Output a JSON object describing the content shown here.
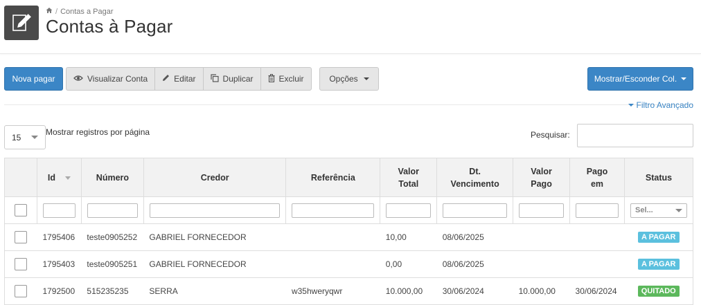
{
  "header": {
    "breadcrumb": [
      "Contas a Pagar"
    ],
    "title": "Contas à Pagar"
  },
  "toolbar": {
    "new_label": "Nova pagar",
    "view_label": "Visualizar Conta",
    "edit_label": "Editar",
    "duplicate_label": "Duplicar",
    "delete_label": "Excluir",
    "options_label": "Opções",
    "columns_label": "Mostrar/Esconder Col."
  },
  "filter_link": "Filtro Avançado",
  "page_size": {
    "value": "15",
    "label": "Mostrar registros por página"
  },
  "search": {
    "label": "Pesquisar:",
    "value": ""
  },
  "table": {
    "columns": [
      {
        "key": "id",
        "label": "Id"
      },
      {
        "key": "numero",
        "label": "Número"
      },
      {
        "key": "credor",
        "label": "Credor"
      },
      {
        "key": "referencia",
        "label": "Referência"
      },
      {
        "key": "valor_total",
        "label": "Valor Total"
      },
      {
        "key": "dt_vencimento",
        "label": "Dt. Vencimento"
      },
      {
        "key": "valor_pago",
        "label": "Valor Pago"
      },
      {
        "key": "pago_em",
        "label": "Pago em"
      },
      {
        "key": "status",
        "label": "Status"
      }
    ],
    "status_filter_placeholder": "Sel...",
    "rows": [
      {
        "id": "1795406",
        "numero": "teste0905252",
        "credor": "GABRIEL FORNECEDOR",
        "referencia": "",
        "valor_total": "10,00",
        "dt_vencimento": "08/06/2025",
        "valor_pago": "",
        "pago_em": "",
        "status": "A PAGAR",
        "status_color": "#5bc0de"
      },
      {
        "id": "1795403",
        "numero": "teste0905251",
        "credor": "GABRIEL FORNECEDOR",
        "referencia": "",
        "valor_total": "0,00",
        "dt_vencimento": "08/06/2025",
        "valor_pago": "",
        "pago_em": "",
        "status": "A PAGAR",
        "status_color": "#5bc0de"
      },
      {
        "id": "1792500",
        "numero": "515235235",
        "credor": "SERRA",
        "referencia": "w35hweryqwr",
        "valor_total": "10.000,00",
        "dt_vencimento": "30/06/2024",
        "valor_pago": "10.000,00",
        "pago_em": "30/06/2024",
        "status": "QUITADO",
        "status_color": "#5cb85c"
      }
    ]
  },
  "colors": {
    "primary": "#3b86c6",
    "info": "#5bc0de",
    "success": "#5cb85c"
  }
}
